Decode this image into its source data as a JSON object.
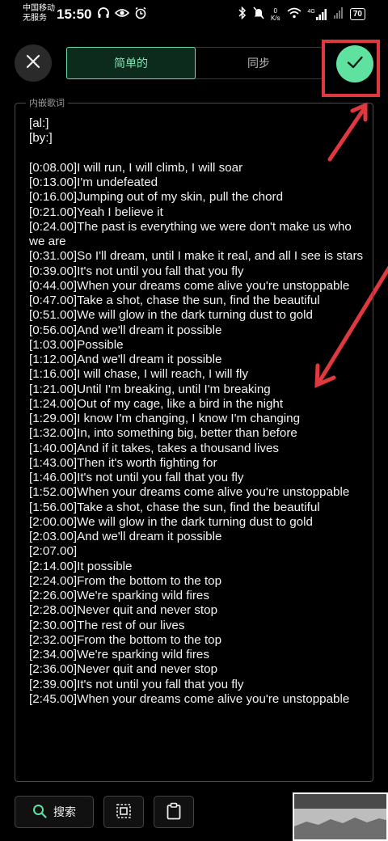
{
  "status_bar": {
    "carrier_1": "中国移动",
    "carrier_2": "无服务",
    "time": "15:50",
    "speed_value": "0",
    "speed_unit": "K/s",
    "network": "4G",
    "battery": "70"
  },
  "tabs": [
    {
      "label": "简单的",
      "active": true
    },
    {
      "label": "同步",
      "active": false
    }
  ],
  "section_label": "内嵌歌词",
  "lyrics_text": "[al:]\n[by:]\n\n[0:08.00]I will run, I will climb, I will soar\n[0:13.00]I'm undefeated\n[0:16.00]Jumping out of my skin, pull the chord\n[0:21.00]Yeah I believe it\n[0:24.00]The past is everything we were don't make us who we are\n[0:31.00]So I'll dream, until I make it real, and all I see is stars\n[0:39.00]It's not until you fall that you fly\n[0:44.00]When your dreams come alive you're unstoppable\n[0:47.00]Take a shot, chase the sun, find the beautiful\n[0:51.00]We will glow in the dark turning dust to gold\n[0:56.00]And we'll dream it possible\n[1:03.00]Possible\n[1:12.00]And we'll dream it possible\n[1:16.00]I will chase, I will reach, I will fly\n[1:21.00]Until I'm breaking, until I'm breaking\n[1:24.00]Out of my cage, like a bird in the night\n[1:29.00]I know I'm changing, I know I'm changing\n[1:32.00]In, into something big, better than before\n[1:40.00]And if it takes, takes a thousand lives\n[1:43.00]Then it's worth fighting for\n[1:46.00]It's not until you fall that you fly\n[1:52.00]When your dreams come alive you're unstoppable\n[1:56.00]Take a shot, chase the sun, find the beautiful\n[2:00.00]We will glow in the dark turning dust to gold\n[2:03.00]And we'll dream it possible\n[2:07.00]\n[2:14.00]It possible\n[2:24.00]From the bottom to the top\n[2:26.00]We're sparking wild fires\n[2:28.00]Never quit and never stop\n[2:30.00]The rest of our lives\n[2:32.00]From the bottom to the top\n[2:34.00]We're sparking wild fires\n[2:36.00]Never quit and never stop\n[2:39.00]It's not until you fall that you fly\n[2:45.00]When your dreams come alive you're unstoppable",
  "bottom_bar": {
    "search_label": "搜索"
  },
  "colors": {
    "accent": "#5fe1a0",
    "annotation": "#e0383f"
  }
}
